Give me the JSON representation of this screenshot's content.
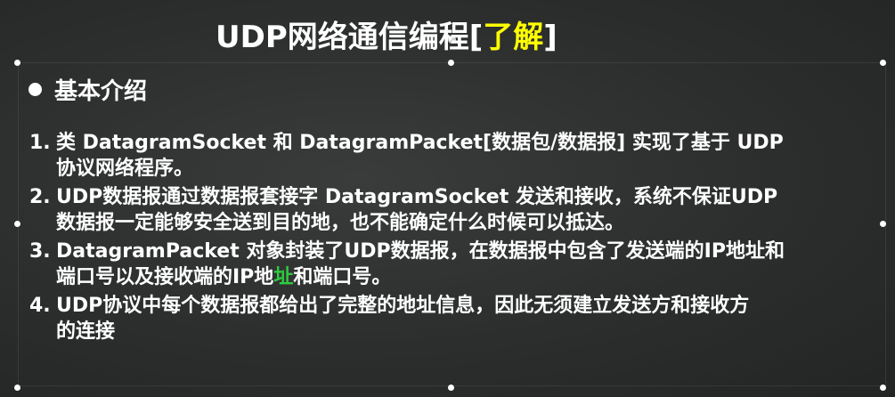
{
  "slide": {
    "title_main": "UDP网络通信编程[",
    "title_highlight": "了解",
    "title_end": "]",
    "heading": "基本介绍",
    "items": [
      {
        "num": "1.",
        "line1": "类 DatagramSocket 和 DatagramPacket[数据包/数据报] 实现了基于 UDP",
        "line2": "协议网络程序。"
      },
      {
        "num": "2.",
        "line1": "UDP数据报通过数据报套接字 DatagramSocket 发送和接收，系统不保证UDP",
        "line2": "数据报一定能够安全送到目的地，也不能确定什么时候可以抵达。"
      },
      {
        "num": "3.",
        "line1": "DatagramPacket 对象封装了UDP数据报，在数据报中包含了发送端的IP地址和",
        "line2a": "端口号以及接收端的IP地",
        "line2b": "址",
        "line2c": "和端口号。"
      },
      {
        "num": "4.",
        "line1": "UDP协议中每个数据报都给出了完整的地址信息，因此无须建立发送方和接收方",
        "line2": "的连接"
      }
    ]
  },
  "colors": {
    "background": "#2a2c2c",
    "text": "#ffffff",
    "highlight": "#ffff00",
    "cursor": "#2ecc40"
  }
}
